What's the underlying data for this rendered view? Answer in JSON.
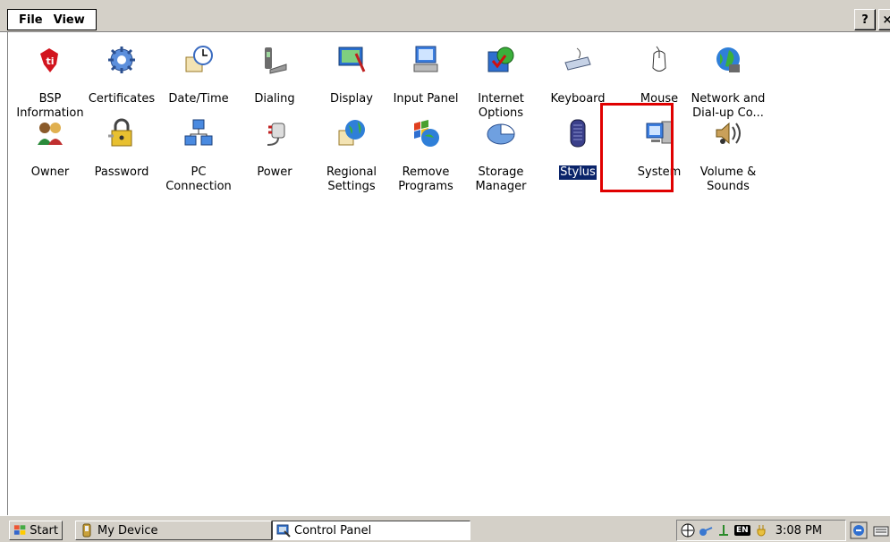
{
  "menu": {
    "file_label": "File",
    "view_label": "View",
    "help_label": "?",
    "close_label": "×"
  },
  "items": [
    {
      "label": "BSP\nInformation",
      "icon": "ti-logo-icon"
    },
    {
      "label": "Certificates",
      "icon": "certificate-gear-icon"
    },
    {
      "label": "Date/Time",
      "icon": "date-time-icon"
    },
    {
      "label": "Dialing",
      "icon": "phone-dialing-icon"
    },
    {
      "label": "Display",
      "icon": "display-icon"
    },
    {
      "label": "Input Panel",
      "icon": "input-panel-icon"
    },
    {
      "label": "Internet\nOptions",
      "icon": "internet-options-icon"
    },
    {
      "label": "Keyboard",
      "icon": "keyboard-icon"
    },
    {
      "label": "Mouse",
      "icon": "mouse-icon"
    },
    {
      "label": "Network and\nDial-up Co...",
      "icon": "network-globe-icon"
    },
    {
      "label": "Owner",
      "icon": "owner-people-icon"
    },
    {
      "label": "Password",
      "icon": "password-lock-icon"
    },
    {
      "label": "PC\nConnection",
      "icon": "pc-connection-icon"
    },
    {
      "label": "Power",
      "icon": "power-plug-icon"
    },
    {
      "label": "Regional\nSettings",
      "icon": "regional-globe-icon"
    },
    {
      "label": "Remove\nPrograms",
      "icon": "remove-programs-icon"
    },
    {
      "label": "Storage\nManager",
      "icon": "storage-disk-icon"
    },
    {
      "label": "Stylus",
      "icon": "stylus-icon",
      "selected": true
    },
    {
      "label": "System",
      "icon": "system-computer-icon"
    },
    {
      "label": "Volume &\nSounds",
      "icon": "volume-speaker-icon"
    }
  ],
  "taskbar": {
    "start_label": "Start",
    "mydevice_label": "My Device",
    "controlpanel_label": "Control Panel",
    "lang_badge": "EN",
    "clock": "3:08 PM"
  },
  "colors": {
    "selection_bg": "#0a246a",
    "highlight_box": "#e00000",
    "chrome": "#d4d0c8"
  }
}
